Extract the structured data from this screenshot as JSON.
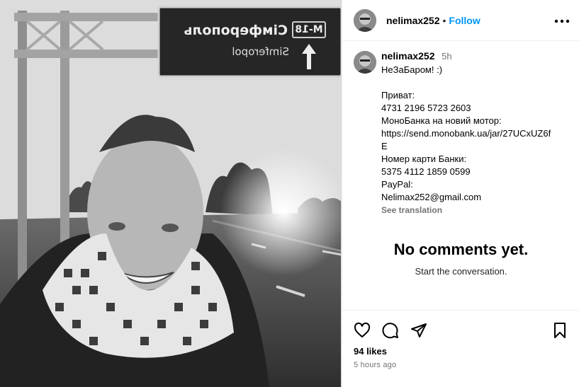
{
  "post": {
    "username": "nelimax252",
    "follow_label": "Follow",
    "separator": "•",
    "photo": {
      "sign_route": "M-18",
      "sign_city_cyr": "Сімферополь",
      "sign_city_lat": "Simferopol"
    }
  },
  "caption": {
    "username": "nelimax252",
    "time": "5h",
    "text": "НеЗаБаром! :)\n\nПриват:\n4731 2196 5723 2603\nМоноБанка на новий мотор:\nhttps://send.monobank.ua/jar/27UCxUZ6fE\nНомер карти Банки:\n5375 4112 1859 0599\nPayPal:\nNelimax252@gmail.com",
    "see_translation": "See translation"
  },
  "comments": {
    "empty_title": "No comments yet.",
    "empty_subtitle": "Start the conversation."
  },
  "footer": {
    "likes": "94 likes",
    "time_ago": "5 hours ago"
  },
  "icons": {
    "like": "heart-icon",
    "comment": "comment-icon",
    "share": "share-icon",
    "save": "bookmark-icon",
    "more": "more-icon"
  },
  "colors": {
    "accent": "#0095f6",
    "secondary_text": "#737373",
    "divider": "#efefef"
  }
}
